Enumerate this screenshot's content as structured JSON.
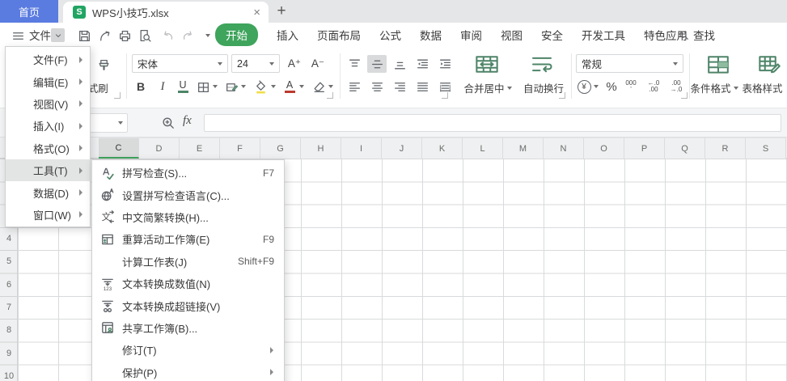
{
  "tab_bar": {
    "home_tab_label": "首页",
    "document_tab": {
      "app_icon_letter": "S",
      "title": "WPS小技巧.xlsx"
    },
    "close_label": "×",
    "new_tab_label": "+"
  },
  "toolbar": {
    "menu_button": "文件",
    "quick_access_icons": [
      "hamburger",
      "chevron-down",
      "save",
      "export",
      "print",
      "print-preview",
      "undo",
      "redo",
      "more-dropdown"
    ],
    "ribbon_tabs": [
      {
        "label": "开始",
        "active": true
      },
      {
        "label": "插入"
      },
      {
        "label": "页面布局"
      },
      {
        "label": "公式"
      },
      {
        "label": "数据"
      },
      {
        "label": "审阅"
      },
      {
        "label": "视图"
      },
      {
        "label": "安全"
      },
      {
        "label": "开发工具"
      },
      {
        "label": "特色应用"
      }
    ],
    "search_label": "查找"
  },
  "ribbon": {
    "format_painter": "格式刷",
    "font_name": "宋体",
    "font_size": "24",
    "number_format": "常规",
    "merge_center": "合并居中",
    "wrap_text": "自动换行",
    "conditional_format": "条件格式",
    "table_style": "表格样式",
    "glyphs": {
      "bold": "B",
      "italic": "I",
      "underline": "U",
      "font_color": "A",
      "increase_font": "A⁺",
      "decrease_font": "A⁻",
      "currency": "¥",
      "percent": "%",
      "thousands": "000",
      "thousands_mark": "’",
      "dec_decrease": [
        "←.0",
        ".00"
      ],
      "dec_increase": [
        ".00",
        "→.0"
      ]
    }
  },
  "formula_bar": {
    "fx_label": "fx",
    "formula_value": ""
  },
  "file_menu": {
    "items": [
      {
        "label": "文件(F)"
      },
      {
        "label": "编辑(E)"
      },
      {
        "label": "视图(V)"
      },
      {
        "label": "插入(I)"
      },
      {
        "label": "格式(O)"
      },
      {
        "label": "工具(T)",
        "highlighted": true
      },
      {
        "label": "数据(D)"
      },
      {
        "label": "窗口(W)"
      }
    ]
  },
  "tools_submenu": {
    "items": [
      {
        "icon": "spellcheck",
        "label": "拼写检查(S)...",
        "shortcut": "F7"
      },
      {
        "icon": "set-language",
        "label": "设置拼写检查语言(C)..."
      },
      {
        "icon": "chinese-convert",
        "label": "中文简繁转换(H)..."
      },
      {
        "icon": "recalculate",
        "label": "重算活动工作簿(E)",
        "shortcut": "F9"
      },
      {
        "label": "计算工作表(J)",
        "shortcut": "Shift+F9"
      },
      {
        "icon": "text-to-number",
        "label": "文本转换成数值(N)"
      },
      {
        "icon": "text-to-hyperlink",
        "label": "文本转换成超链接(V)"
      },
      {
        "icon": "share-workbook",
        "label": "共享工作簿(B)..."
      },
      {
        "label": "修订(T)",
        "has_submenu": true
      },
      {
        "label": "保护(P)",
        "has_submenu": true
      }
    ]
  },
  "sheet": {
    "columns": [
      "C",
      "D",
      "E",
      "F",
      "G",
      "H",
      "I",
      "J",
      "K",
      "L",
      "M",
      "N",
      "O",
      "P",
      "Q",
      "R",
      "S"
    ],
    "selected_column": "C",
    "row_numbers": [
      "4",
      "5",
      "6",
      "7",
      "8",
      "9",
      "10"
    ]
  },
  "colors": {
    "accent_green": "#3FA45C",
    "icon_green": "#4e8468",
    "home_tab_blue": "#5A7BE0",
    "logo_green": "#21A562",
    "fill_yellow": "#F2DE49",
    "font_color_red": "#BB3A2E"
  }
}
